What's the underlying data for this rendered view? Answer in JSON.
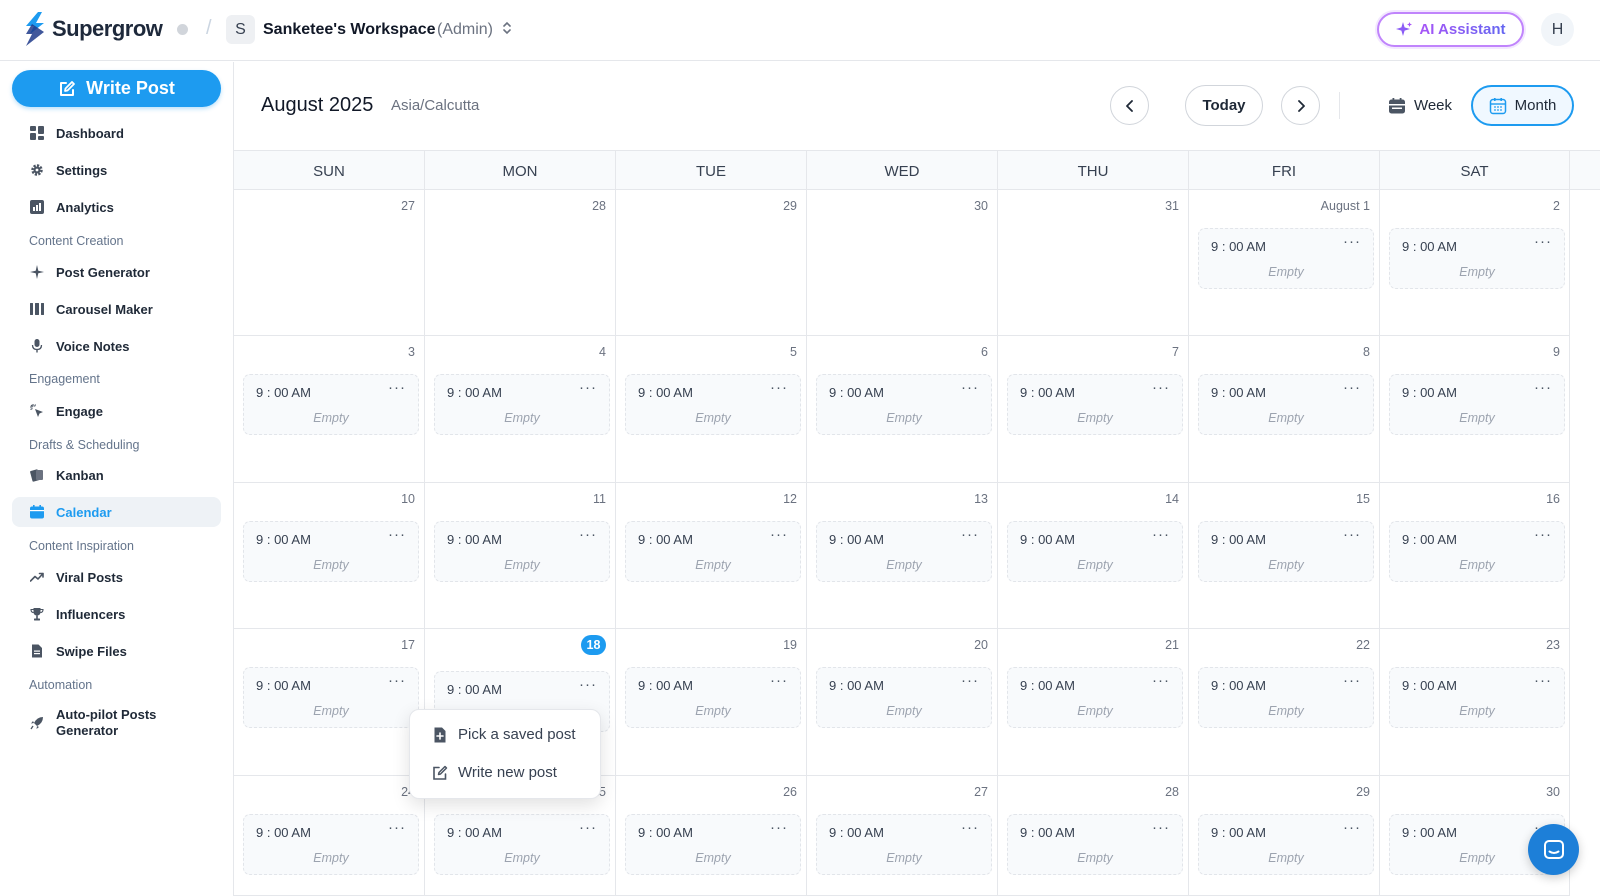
{
  "app": {
    "name": "Supergrow"
  },
  "workspace": {
    "avatar": "S",
    "name": "Sanketee's Workspace",
    "role": "(Admin)"
  },
  "ai_assistant": {
    "label": "AI Assistant"
  },
  "user": {
    "avatar": "H"
  },
  "sidebar": {
    "write_post": "Write Post",
    "items": [
      {
        "label": "Dashboard",
        "icon": "dashboard-icon"
      },
      {
        "label": "Settings",
        "icon": "gear-icon"
      },
      {
        "label": "Analytics",
        "icon": "analytics-icon"
      },
      {
        "section": "Content Creation"
      },
      {
        "label": "Post Generator",
        "icon": "sparkle-icon"
      },
      {
        "label": "Carousel Maker",
        "icon": "carousel-icon"
      },
      {
        "label": "Voice Notes",
        "icon": "microphone-icon"
      },
      {
        "section": "Engagement"
      },
      {
        "label": "Engage",
        "icon": "cursor-click-icon"
      },
      {
        "section": "Drafts & Scheduling"
      },
      {
        "label": "Kanban",
        "icon": "kanban-icon"
      },
      {
        "label": "Calendar",
        "icon": "calendar-icon",
        "active": true
      },
      {
        "section": "Content Inspiration"
      },
      {
        "label": "Viral Posts",
        "icon": "trend-icon"
      },
      {
        "label": "Influencers",
        "icon": "trophy-icon"
      },
      {
        "label": "Swipe Files",
        "icon": "file-icon"
      },
      {
        "section": "Automation"
      },
      {
        "label": "Auto-pilot Posts\nGenerator",
        "icon": "rocket-icon"
      }
    ]
  },
  "calendar": {
    "title": "August 2025",
    "timezone": "Asia/Calcutta",
    "today_label": "Today",
    "week_label": "Week",
    "month_label": "Month",
    "days_of_week": [
      "SUN",
      "MON",
      "TUE",
      "WED",
      "THU",
      "FRI",
      "SAT"
    ],
    "slot_time": "9 : 00 AM",
    "slot_more": "···",
    "slot_empty": "Empty",
    "weeks": [
      [
        {
          "n": "27",
          "slot": false
        },
        {
          "n": "28",
          "slot": false
        },
        {
          "n": "29",
          "slot": false
        },
        {
          "n": "30",
          "slot": false
        },
        {
          "n": "31",
          "slot": false
        },
        {
          "n": "August  1",
          "slot": true
        },
        {
          "n": "2",
          "slot": true
        }
      ],
      [
        {
          "n": "3",
          "slot": true
        },
        {
          "n": "4",
          "slot": true
        },
        {
          "n": "5",
          "slot": true
        },
        {
          "n": "6",
          "slot": true
        },
        {
          "n": "7",
          "slot": true
        },
        {
          "n": "8",
          "slot": true
        },
        {
          "n": "9",
          "slot": true
        }
      ],
      [
        {
          "n": "10",
          "slot": true
        },
        {
          "n": "11",
          "slot": true
        },
        {
          "n": "12",
          "slot": true
        },
        {
          "n": "13",
          "slot": true
        },
        {
          "n": "14",
          "slot": true
        },
        {
          "n": "15",
          "slot": true
        },
        {
          "n": "16",
          "slot": true
        }
      ],
      [
        {
          "n": "17",
          "slot": true
        },
        {
          "n": "18",
          "slot": true,
          "today": true
        },
        {
          "n": "19",
          "slot": true
        },
        {
          "n": "20",
          "slot": true
        },
        {
          "n": "21",
          "slot": true
        },
        {
          "n": "22",
          "slot": true
        },
        {
          "n": "23",
          "slot": true
        }
      ],
      [
        {
          "n": "24",
          "slot": true
        },
        {
          "n": "25",
          "slot": true
        },
        {
          "n": "26",
          "slot": true
        },
        {
          "n": "27",
          "slot": true
        },
        {
          "n": "28",
          "slot": true
        },
        {
          "n": "29",
          "slot": true
        },
        {
          "n": "30",
          "slot": true
        }
      ]
    ]
  },
  "popup": {
    "pick_saved": "Pick a saved post",
    "write_new": "Write new post"
  },
  "colors": {
    "accent": "#1d9bf0",
    "ai_gradient_start": "#a855f7",
    "ai_gradient_end": "#6366f1"
  }
}
